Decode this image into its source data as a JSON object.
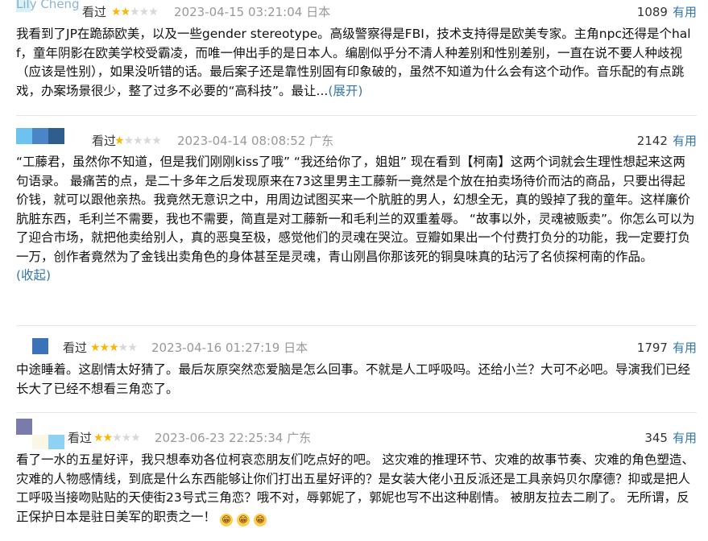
{
  "reviews": [
    {
      "user": "Lily Cheng",
      "watched_label": "看过",
      "rating": 2,
      "time": "2023-04-15 03:21:04",
      "location": "日本",
      "votes": "1089",
      "vote_label": "有用",
      "text": "我看到了JP在跪舔欧美，以及一些gender stereotype。高级警察得是FBI，技术支持得是欧美专家。主角npc还得是个half，童年阴影在欧美学校受霸凌，而唯一伸出手的是日本人。编剧似乎分不清人种差别和性别差别，一直在说不要人种歧视（应该是性别），如果没听错的话。最后案子还是靠性别固有印象破的，虽然不知道为什么会有这个动作。音乐配的有点跳戏，办案场景很少，整了过多不必要的“高科技”。最让...",
      "toggle": "(展开)",
      "avatar_colors": [
        "#d8f3f7"
      ]
    },
    {
      "user": "",
      "watched_label": "看过",
      "rating": 1,
      "time": "2023-04-14 08:08:52",
      "location": "广东",
      "votes": "2142",
      "vote_label": "有用",
      "text": "“工藤君，虽然你不知道，但是我们刚刚kiss了哦” “我还给你了，姐姐” 现在看到【柯南】这两个词就会生理性想起来这两句语录。 最痛苦的点，是二十多年之后发现原来在73这里男主工藤新一竟然是个放在拍卖场待价而沽的商品，只要出得起价钱，就可以跟他亲热。我竟然无意识之中，用周边试图买来一个肮脏的男人，幻想全无，真的毁掉了我的童年。这样廉价肮脏东西，毛利兰不需要，我也不需要，简直是对工藤新一和毛利兰的双重羞辱。 “故事以外，灵魂被贩卖”。你怎么可以为了迎合市场，就把他卖给别人，真的恶臭至极，感觉他们的灵魂在哭泣。豆瓣如果出一个付费打负分的功能，我一定要打负一万，创作者竟然为了金钱出卖角色的身体甚至是灵魂，青山刚昌你那该死的铜臭味真的玷污了名侦探柯南的作品。",
      "toggle": "(收起)",
      "avatar_colors": [
        "#6cc3f0",
        "#4a86c5",
        "#2f5d8e"
      ]
    },
    {
      "user": "",
      "watched_label": "看过",
      "rating": 3,
      "time": "2023-04-16 01:27:19",
      "location": "日本",
      "votes": "1797",
      "vote_label": "有用",
      "text": "中途睡着。这剧情太好猜了。最后灰原突然恋爱脑是怎么回事。不就是人工呼吸吗。还给小兰？大可不必吧。导演我们已经长大了已经不想看三角恋了。",
      "toggle": "",
      "avatar_colors": [
        "#3b72b8"
      ]
    },
    {
      "user": "",
      "watched_label": "看过",
      "rating": 2,
      "time": "2023-06-23 22:25:34",
      "location": "广东",
      "votes": "345",
      "vote_label": "有用",
      "text": "看了一水的五星好评，我只想奉劝各位柯哀恋朋友们吃点好的吧。 这灾难的推理环节、灾难的故事节奏、灾难的角色塑造、灾难的人物感情线，到底是什么东西能够让你们打出五星好评的？是女装大佬小丑反派还是工具亲妈贝尔摩德？抑或是把人工呼吸当接吻贴贴的天使街23号式三角恋？哦不对，辱郭妮了，郭妮也写不出这种剧情。 被朋友拉去二刷了。 无所谓，反正保护日本是驻日美军的职责之一！",
      "toggle": "",
      "avatar_colors": [
        "#7b7bab",
        "#fbf7e6",
        "#8fd0f5"
      ],
      "emojis": [
        "😁",
        "😁",
        "😁"
      ]
    }
  ]
}
